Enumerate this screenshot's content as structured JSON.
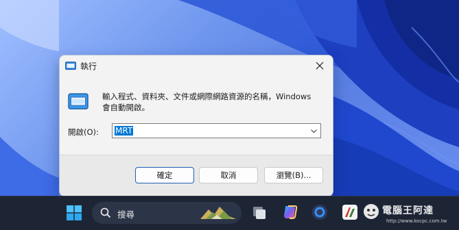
{
  "dialog": {
    "title": "執行",
    "description": "輸入程式、資料夾、文件或網際網路資源的名稱，Windows\n會自動開啟。",
    "open_label": "開啟(O):",
    "open_value": "MRT",
    "ok_label": "確定",
    "cancel_label": "取消",
    "browse_label": "瀏覽(B)..."
  },
  "taskbar": {
    "search_label": "搜尋",
    "watermark_text": "電腦王阿達",
    "watermark_url": "http://www.kocpc.com.tw"
  },
  "icons": {
    "title": "run-window-icon",
    "dialog": "run-window-icon",
    "close": "close-icon",
    "dropdown": "chevron-down-icon",
    "start": "windows-logo-icon",
    "search": "search-icon",
    "taskview": "task-view-icon",
    "copilot": "copilot-icon",
    "app3": "app-icon",
    "app4": "app-icon"
  },
  "colors": {
    "accent": "#0078d4",
    "taskbar": "#1d2535",
    "dialog_bg": "#f3f3f3",
    "wallpaper": "#2f5ed8"
  }
}
